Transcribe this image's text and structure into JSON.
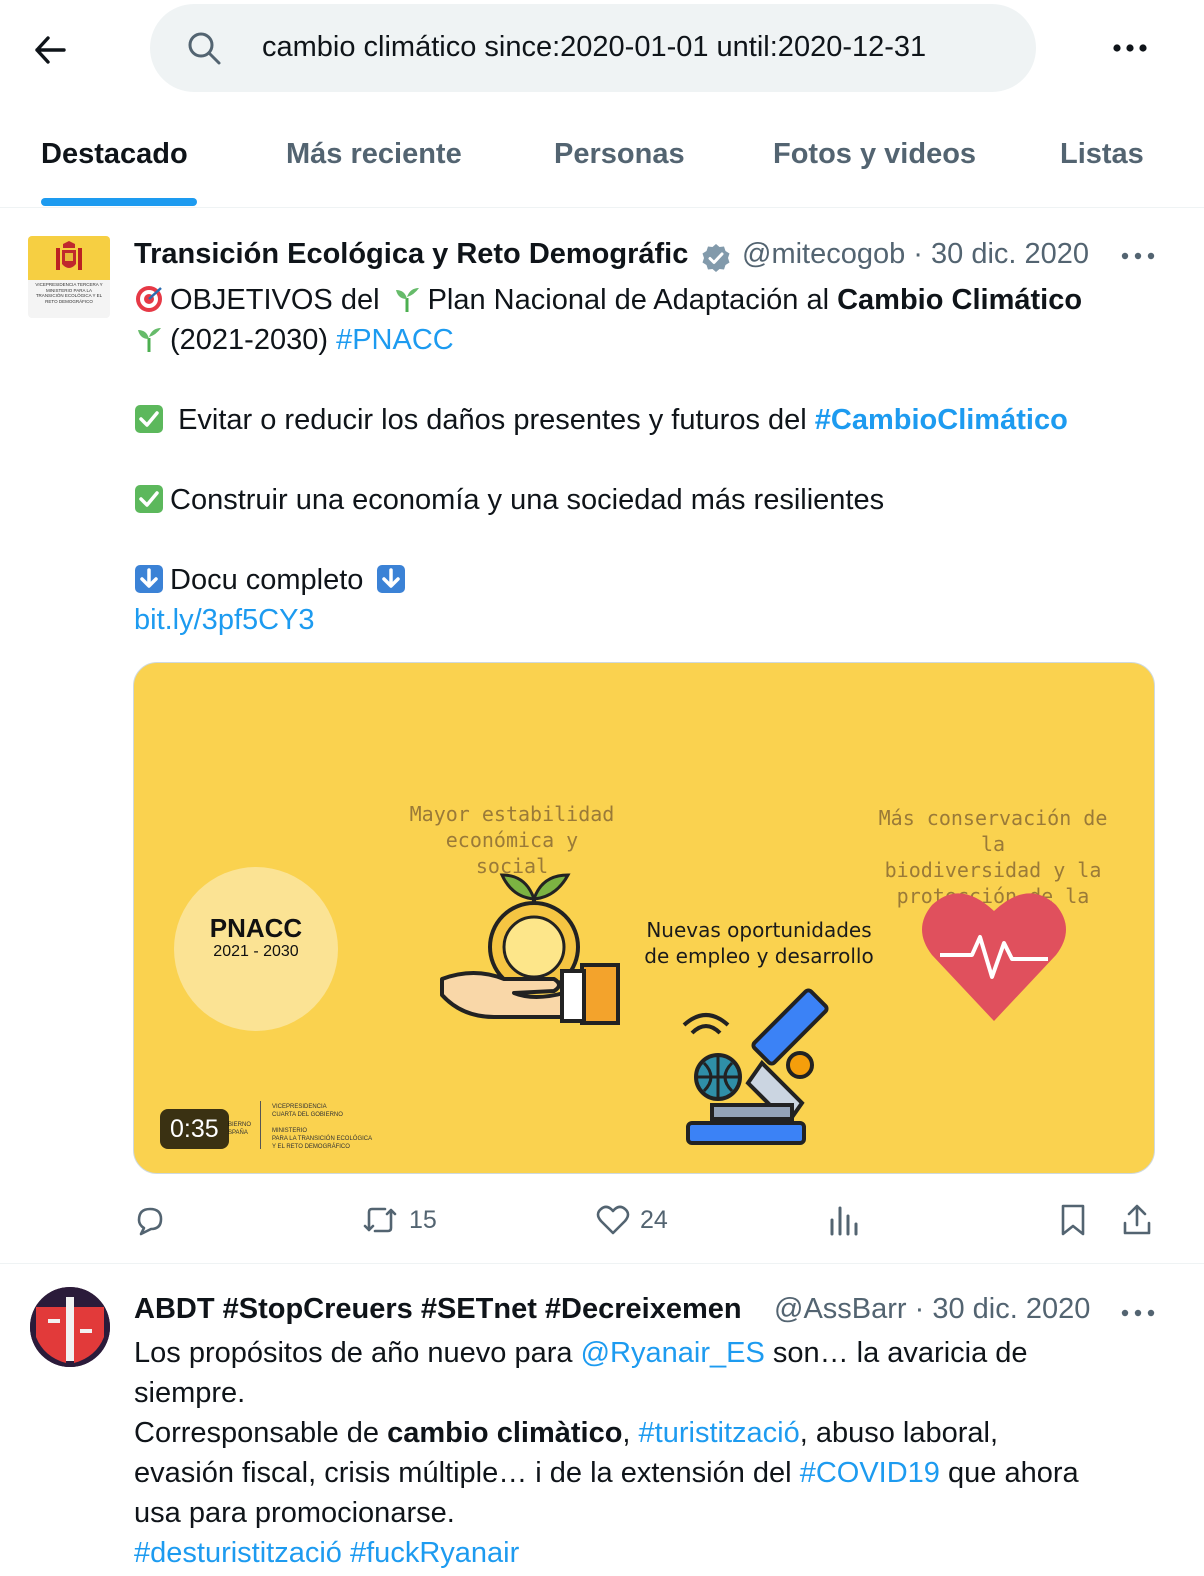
{
  "search": {
    "query": "cambio climático since:2020-01-01 until:2020-12-31"
  },
  "tabs": [
    {
      "label": "Destacado",
      "active": true
    },
    {
      "label": "Más reciente"
    },
    {
      "label": "Personas"
    },
    {
      "label": "Fotos y videos"
    },
    {
      "label": "Listas"
    }
  ],
  "tweets": [
    {
      "author": "Transición Ecológica y Reto Demográfic",
      "verified": true,
      "handle_date": "@mitecogob · 30 dic. 2020",
      "avatar_text": "VICEPRESIDENCIA TERCERA Y MINISTERIO PARA LA TRANSICIÓN ECOLÓGICA Y EL RETO DEMOGRÁFICO",
      "body": {
        "l1_a": "OBJETIVOS del",
        "l1_b": "Plan Nacional de Adaptación al",
        "l1_bold": "Cambio Climático",
        "l2_a": "(2021-2030)",
        "l2_tag": "#PNACC",
        "p2_a": "Evitar o reducir los daños presentes y futuros del",
        "p2_tag": "#CambioClimático",
        "p3": "Construir una economía y una sociedad más resilientes",
        "p4": "Docu completo",
        "link": "bit.ly/3pf5CY3"
      },
      "media": {
        "pnacc_title": "PNACC",
        "pnacc_years": "2021 - 2030",
        "cap1": "Mayor estabilidad\neconómica y social",
        "cap2": "Nuevas oportunidades\nde empleo y desarrollo",
        "cap3": "Más conservación de la\nbiodiversidad y la\nprotección de la salud",
        "duration": "0:35",
        "logo_text": "VICEPRESIDENCIA\nCUARTA DEL GOBIERNO\n\nMINISTERIO\nPARA LA TRANSICIÓN ECOLÓGICA\nY EL RETO DEMOGRÁFICO",
        "logo_left": "BIERNO\nSPAÑA"
      },
      "stats": {
        "retweets": "15",
        "likes": "24"
      }
    },
    {
      "author": "ABDT #StopCreuers #SETnet #Decreixemen",
      "handle_date": "@AssBarr · 30 dic. 2020",
      "body": {
        "l1_a": "Los propósitos de año nuevo para",
        "l1_mention": "@Ryanair_ES",
        "l1_b": "son… la avaricia de",
        "l2": "siempre.",
        "l3_a": "Corresponsable de",
        "l3_bold": "cambio climàtico",
        "l3_b": ",",
        "l3_tag": "#turistització",
        "l3_c": ", abuso laboral,",
        "l4_a": "evasión fiscal, crisis múltiple… i de la extensión del",
        "l4_tag": "#COVID19",
        "l4_b": "que ahora",
        "l5": "usa para promocionarse.",
        "l6_tag1": "#desturistització",
        "l6_tag2": "#fuckRyanair"
      }
    }
  ],
  "colors": {
    "accent": "#1d9bf0",
    "text": "#0f1419",
    "muted": "#536471",
    "media_bg": "#fad24f"
  }
}
